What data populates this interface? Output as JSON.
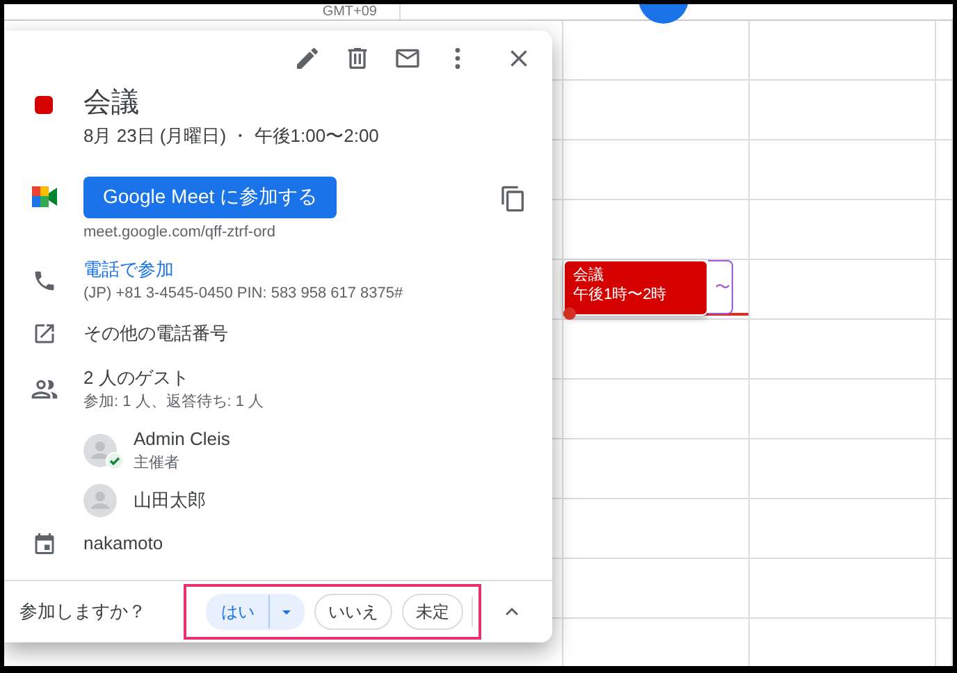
{
  "calendar": {
    "timezone": "GMT+09",
    "events": [
      {
        "kind": "filled",
        "title": "会議",
        "time": "午後1時〜2時",
        "color": "#d50000"
      },
      {
        "kind": "outlined",
        "text": "〜",
        "color": "#a259d9"
      }
    ]
  },
  "popup": {
    "title": "会議",
    "color": "#d50000",
    "date": "8月 23日 (月曜日) ・ 午後1:00〜2:00",
    "meet": {
      "button": "Google Meet に参加する",
      "link": "meet.google.com/qff-ztrf-ord"
    },
    "phone": {
      "link": "電話で参加",
      "details": "(JP) +81 3-4545-0450 PIN: 583 958 617 8375#"
    },
    "more_numbers": "その他の電話番号",
    "guests": {
      "title": "2 人のゲスト",
      "summary": "参加: 1 人、返答待ち: 1 人",
      "list": [
        {
          "name": "Admin Cleis",
          "role": "主催者",
          "accepted": true
        },
        {
          "name": "山田太郎",
          "accepted": false
        }
      ]
    },
    "calendar_name": "nakamoto",
    "rsvp": {
      "question": "参加しますか？",
      "options": [
        {
          "label": "はい",
          "selected": true
        },
        {
          "label": "いいえ",
          "selected": false
        },
        {
          "label": "未定",
          "selected": false
        }
      ]
    }
  }
}
